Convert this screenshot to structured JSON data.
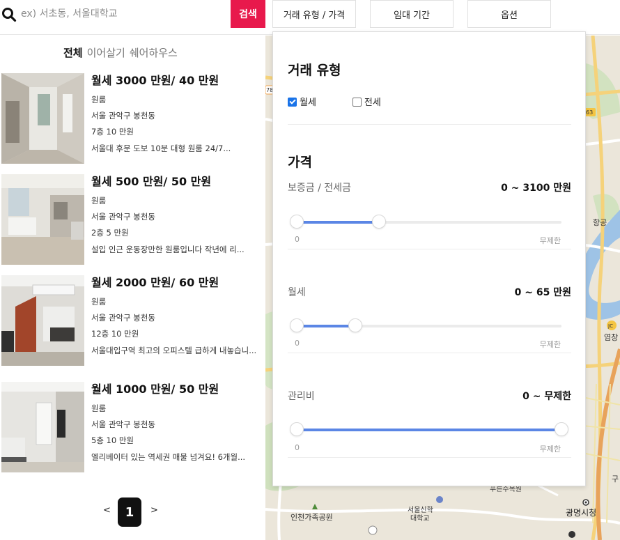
{
  "search": {
    "placeholder": "ex) 서초동, 서울대학교",
    "button_label": "검색"
  },
  "filters": {
    "deal_type_price": "거래 유형 / 가격",
    "lease_period": "임대 기간",
    "options": "옵션"
  },
  "tabs": [
    {
      "label": "전체",
      "active": true
    },
    {
      "label": "이어살기",
      "active": false
    },
    {
      "label": "쉐어하우스",
      "active": false
    }
  ],
  "listings": [
    {
      "price": "월세 3000 만원/ 40 만원",
      "room_type": "원룸",
      "address": "서울 관악구 봉천동",
      "floor_fee": "7층 10 만원",
      "description": "서울대 후문 도보 10분 대형 원룸 24/7..."
    },
    {
      "price": "월세 500 만원/ 50 만원",
      "room_type": "원룸",
      "address": "서울 관악구 봉천동",
      "floor_fee": "2층 5 만원",
      "description": "설입 인근 운동장만한 원룸입니다 작년에 리..."
    },
    {
      "price": "월세 2000 만원/ 60 만원",
      "room_type": "원룸",
      "address": "서울 관악구 봉천동",
      "floor_fee": "12층 10 만원",
      "description": "서울대입구역 최고의 오피스텔 급하게 내놓습니..."
    },
    {
      "price": "월세 1000 만원/ 50 만원",
      "room_type": "원룸",
      "address": "서울 관악구 봉천동",
      "floor_fee": "5층 10 만원",
      "description": "엘리베이터 있는 역세권 매물 넘겨요! 6개월..."
    }
  ],
  "pagination": {
    "prev": "<",
    "current": "1",
    "next": ">"
  },
  "dropdown": {
    "deal_type_heading": "거래 유형",
    "monthly_label": "월세",
    "monthly_checked": true,
    "jeonse_label": "전세",
    "jeonse_checked": false,
    "price_heading": "가격",
    "deposit": {
      "label": "보증금 / 전세금",
      "value": "0 ~ 3100 만원",
      "min": "0",
      "max": "무제한",
      "fill_fraction": 0.31
    },
    "rent": {
      "label": "월세",
      "value": "0 ~ 65 만원",
      "min": "0",
      "max": "무제한",
      "fill_fraction": 0.22
    },
    "maintenance": {
      "label": "관리비",
      "value": "0 ~ 무제한",
      "min": "0",
      "max": "무제한",
      "fill_fraction": 1.0
    }
  },
  "map_labels": {
    "park": "인천가족공원",
    "university": "서울신학\n대학교",
    "city_hall": "광명시청",
    "station": "푸른수목원",
    "road_63": "63",
    "road_78": "78",
    "jc": "JC",
    "yeomchang": "염창",
    "hanggong": "항공",
    "gu": "구"
  },
  "colors": {
    "accent": "#e8194c",
    "slider": "#5b86e5",
    "checkbox": "#1a73e8"
  }
}
